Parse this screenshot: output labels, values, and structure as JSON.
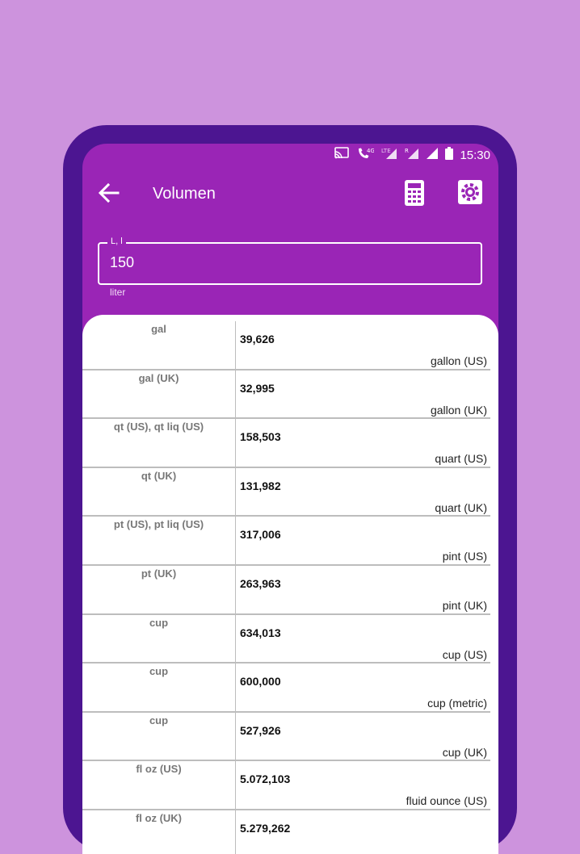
{
  "status_bar": {
    "time": "15:30",
    "network": "4G",
    "lte": "LTE",
    "roaming": "R"
  },
  "app_bar": {
    "title": "Volumen"
  },
  "input": {
    "label": "L, l",
    "value": "150",
    "helper": "liter"
  },
  "conversions": [
    {
      "abbr": "gal",
      "value": "39,626",
      "name": "gallon (US)"
    },
    {
      "abbr": "gal (UK)",
      "value": "32,995",
      "name": "gallon (UK)"
    },
    {
      "abbr": "qt (US), qt liq (US)",
      "value": "158,503",
      "name": "quart (US)"
    },
    {
      "abbr": "qt (UK)",
      "value": "131,982",
      "name": "quart (UK)"
    },
    {
      "abbr": "pt (US), pt liq (US)",
      "value": "317,006",
      "name": "pint (US)"
    },
    {
      "abbr": "pt (UK)",
      "value": "263,963",
      "name": "pint (UK)"
    },
    {
      "abbr": "cup",
      "value": "634,013",
      "name": "cup (US)"
    },
    {
      "abbr": "cup",
      "value": "600,000",
      "name": "cup (metric)"
    },
    {
      "abbr": "cup",
      "value": "527,926",
      "name": "cup (UK)"
    },
    {
      "abbr": "fl oz (US)",
      "value": "5.072,103",
      "name": "fluid ounce (US)"
    },
    {
      "abbr": "fl oz (UK)",
      "value": "5.279,262",
      "name": ""
    }
  ],
  "colors": {
    "background": "#cd93dd",
    "phone_frame": "#4c1591",
    "app_primary": "#9a25b6",
    "card": "#ffffff",
    "divider": "#bdbdbd"
  },
  "icons": {
    "back": "arrow-left-icon",
    "calculator": "calculator-icon",
    "settings": "settings-icon",
    "cast": "cast-icon",
    "call": "wifi-call-icon",
    "signal": "signal-icon",
    "battery": "battery-icon"
  }
}
